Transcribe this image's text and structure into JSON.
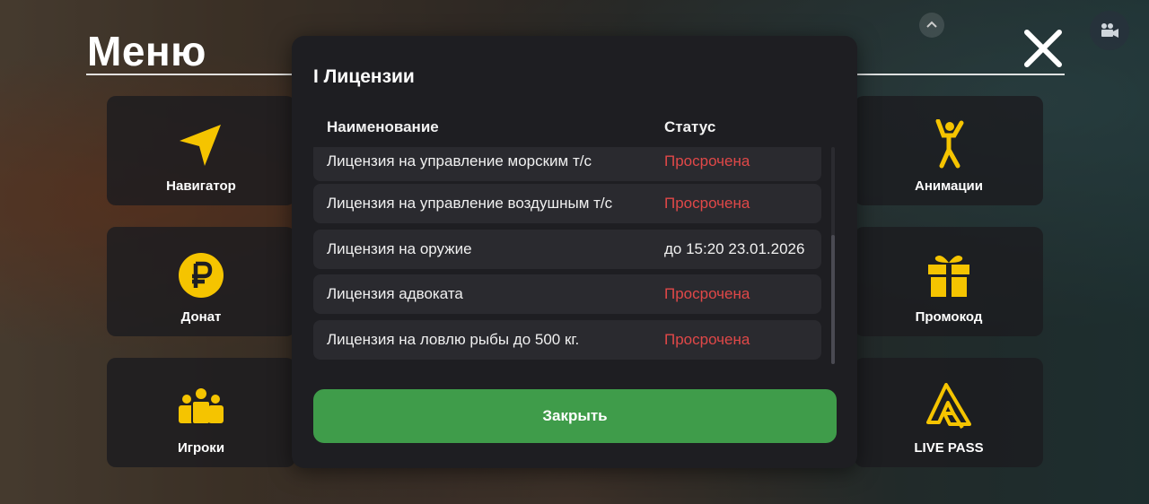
{
  "menu": {
    "title": "Меню",
    "tiles": [
      {
        "label": "Навигатор",
        "icon": "navigator-arrow-icon"
      },
      {
        "label": "Донат",
        "icon": "ruble-coin-icon"
      },
      {
        "label": "Игроки",
        "icon": "players-group-icon"
      },
      {
        "label": "Анимации",
        "icon": "animation-figure-icon"
      },
      {
        "label": "Промокод",
        "icon": "gift-box-icon"
      },
      {
        "label": "LIVE PASS",
        "icon": "live-pass-logo-icon"
      }
    ]
  },
  "modal": {
    "title": "I Лицензии",
    "columns": {
      "name": "Наименование",
      "status": "Статус"
    },
    "rows": [
      {
        "name": "Лицензия на управление морским т/с",
        "status": "Просрочена",
        "status_color": "#e04848"
      },
      {
        "name": "Лицензия на управление воздушным т/с",
        "status": "Просрочена",
        "status_color": "#e04848"
      },
      {
        "name": "Лицензия на оружие",
        "status": "до 15:20 23.01.2026",
        "status_color": "#f0f0f0"
      },
      {
        "name": "Лицензия адвоката",
        "status": "Просрочена",
        "status_color": "#e04848"
      },
      {
        "name": "Лицензия на ловлю рыбы до 500 кг.",
        "status": "Просрочена",
        "status_color": "#e04848"
      }
    ],
    "close_label": "Закрыть"
  },
  "colors": {
    "accent_yellow": "#f5c400",
    "expired_red": "#e04848",
    "button_green": "#3f9c4a"
  }
}
